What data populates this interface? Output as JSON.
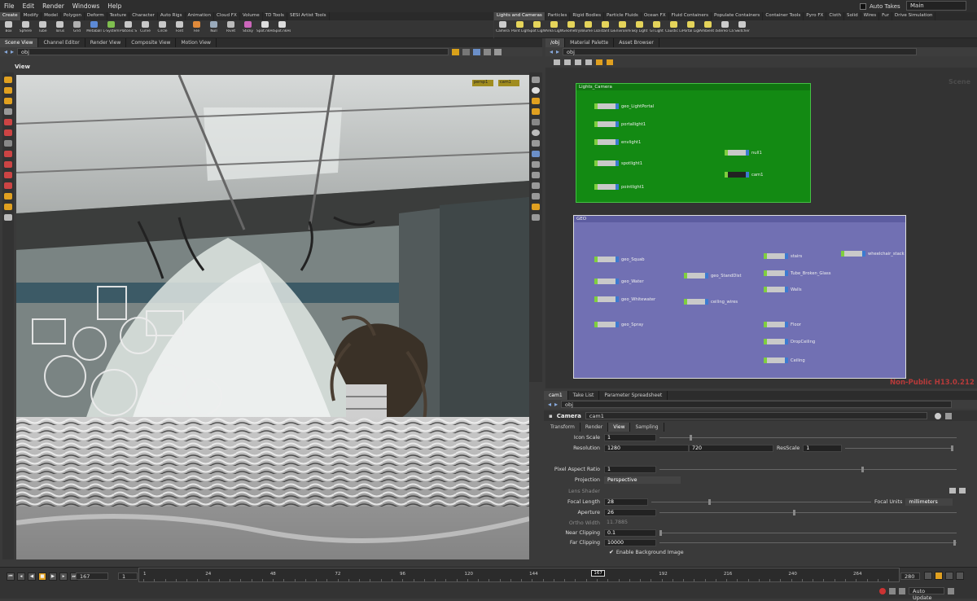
{
  "menu": [
    "File",
    "Edit",
    "Render",
    "Windows",
    "Help"
  ],
  "takes": {
    "auto_takes": "Auto Takes",
    "desktop": "Main"
  },
  "shelf_left": {
    "tabs": [
      "Create",
      "Modify",
      "Model",
      "Polygon",
      "Deform",
      "Texture",
      "Character",
      "Auto Rigs",
      "Animation",
      "Cloud FX",
      "Volume",
      "TD Tools",
      "SESI Artist Tools"
    ],
    "tools": [
      {
        "label": "Box",
        "color": "#c8c8c8"
      },
      {
        "label": "Sphere",
        "color": "#c8c8c8"
      },
      {
        "label": "Tube",
        "color": "#c8c8c8"
      },
      {
        "label": "Torus",
        "color": "#c8c8c8"
      },
      {
        "label": "Grid",
        "color": "#b0b0b0"
      },
      {
        "label": "Metaball",
        "color": "#5c8ad6"
      },
      {
        "label": "L-System",
        "color": "#7fbf4f"
      },
      {
        "label": "Platonic So...",
        "color": "#c8c8c8"
      },
      {
        "label": "Curve",
        "color": "#c8c8c8"
      },
      {
        "label": "Circle",
        "color": "#c8c8c8"
      },
      {
        "label": "Font",
        "color": "#c8c8c8"
      },
      {
        "label": "File",
        "color": "#e08a3a"
      },
      {
        "label": "Null",
        "color": "#9ab"
      },
      {
        "label": "Rivet",
        "color": "#bbb"
      },
      {
        "label": "Sticky",
        "color": "#c6b"
      },
      {
        "label": "Spot.nkHop",
        "color": "#ddd"
      },
      {
        "label": "Spot.nkHop",
        "color": "#ddd"
      }
    ]
  },
  "shelf_right": {
    "tabs": [
      "Lights and Cameras",
      "Particles",
      "Rigid Bodies",
      "Particle Fluids",
      "Ocean FX",
      "Fluid Containers",
      "Populate Containers",
      "Container Tools",
      "Pyro FX",
      "Cloth",
      "Solid",
      "Wires",
      "Fur",
      "Drive Simulation"
    ],
    "tools": [
      {
        "label": "Camera",
        "color": "#ccc"
      },
      {
        "label": "Point Light",
        "color": "#e5d45a"
      },
      {
        "label": "Spot Light",
        "color": "#e5d45a"
      },
      {
        "label": "Area Light",
        "color": "#e5d45a"
      },
      {
        "label": "Geometry...",
        "color": "#e5d45a"
      },
      {
        "label": "Volume Li...",
        "color": "#e5d45a"
      },
      {
        "label": "Distant Light",
        "color": "#e5d45a"
      },
      {
        "label": "Environme...",
        "color": "#e5d45a"
      },
      {
        "label": "Sky Light",
        "color": "#e5d45a"
      },
      {
        "label": "GI Light",
        "color": "#e5d45a"
      },
      {
        "label": "Caustic Li...",
        "color": "#e5d45a"
      },
      {
        "label": "Portal Light",
        "color": "#e5d45a"
      },
      {
        "label": "Ambient Li...",
        "color": "#e5d45a"
      },
      {
        "label": "Stereo Ca...",
        "color": "#ccc"
      },
      {
        "label": "Switcher",
        "color": "#ccc"
      }
    ]
  },
  "left_tabs": [
    "Scene View",
    "Channel Editor",
    "Render View",
    "Composite View",
    "Motion View"
  ],
  "left_path": "obj",
  "view_title": "View",
  "viewport_menus": [
    "persp1",
    "cam1"
  ],
  "right_tabs": [
    "/obj",
    "Material Palette",
    "Asset Browser"
  ],
  "right_path": "obj",
  "scene_label": "Scene",
  "boxes": [
    {
      "title": "Lights_Camera"
    },
    {
      "title": "GEO"
    }
  ],
  "nodes_light": [
    "geo_LightPortal",
    "portallight1",
    "envlight1",
    "spotlight1",
    "pointlight1",
    "null1",
    "cam1"
  ],
  "nodes_geo": [
    "geo_Squab",
    "geo_Water",
    "geo_Whitewater",
    "geo_Spray",
    "geo_StandDist",
    "ceiling_wires",
    "stairs",
    "Tube_Broken_Glass",
    "Walls",
    "Floor",
    "DropCeiling",
    "Ceiling",
    "wheelchair_stack"
  ],
  "watermark": "Non-Public H13.0.212",
  "param_tabs": [
    "cam1",
    "Take List",
    "Parameter Spreadsheet"
  ],
  "param_path": "obj",
  "node_type": "Camera",
  "node_name": "cam1",
  "ptabs": [
    "Transform",
    "Render",
    "View",
    "Sampling"
  ],
  "params": {
    "icon_scale": {
      "label": "Icon Scale",
      "value": "1"
    },
    "resolution": {
      "label": "Resolution",
      "w": "1280",
      "h": "720",
      "res_label": "ResScale",
      "res": "1"
    },
    "pixel_aspect": {
      "label": "Pixel Aspect Ratio",
      "value": "1"
    },
    "projection": {
      "label": "Projection",
      "value": "Perspective"
    },
    "lens_shader": {
      "label": "Lens Shader"
    },
    "focal_length": {
      "label": "Focal Length",
      "value": "28",
      "units_label": "Focal Units",
      "units": "millimeters"
    },
    "aperture": {
      "label": "Aperture",
      "value": "26"
    },
    "ortho_width": {
      "label": "Ortho Width",
      "value": "11.7885"
    },
    "near": {
      "label": "Near Clipping",
      "value": "0.1"
    },
    "far": {
      "label": "Far Clipping",
      "value": "10000"
    },
    "bg_image": {
      "label": "Enable Background Image"
    }
  },
  "timeline": {
    "frame": "167",
    "start": "1",
    "end": "280",
    "ticks": [
      "1",
      "24",
      "48",
      "72",
      "96",
      "120",
      "144",
      "167",
      "192",
      "216",
      "240",
      "264"
    ],
    "cursor": "167"
  },
  "status": {
    "auto_update": "Auto Update"
  },
  "colors": {
    "light_box": "#138a13",
    "geo_box": "#7170b3",
    "watermark": "#b63a3a"
  }
}
